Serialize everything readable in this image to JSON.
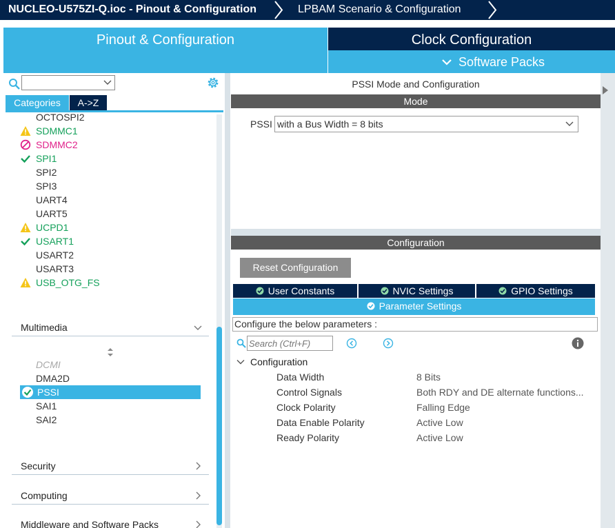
{
  "breadcrumb": {
    "project": "NUCLEO-U575ZI-Q.ioc - Pinout & Configuration",
    "step2": "LPBAM Scenario & Configuration"
  },
  "tabs": {
    "pinout": "Pinout & Configuration",
    "clock": "Clock Configuration",
    "software_packs": "Software Packs"
  },
  "left": {
    "search_value": "",
    "category_tabs": [
      "Categories",
      "A->Z"
    ],
    "connectivity_items": [
      {
        "label": "OCTOSPI2",
        "status": "none"
      },
      {
        "label": "SDMMC1",
        "status": "warning"
      },
      {
        "label": "SDMMC2",
        "status": "disabled"
      },
      {
        "label": "SPI1",
        "status": "ok"
      },
      {
        "label": "SPI2",
        "status": "none"
      },
      {
        "label": "SPI3",
        "status": "none"
      },
      {
        "label": "UART4",
        "status": "none"
      },
      {
        "label": "UART5",
        "status": "none"
      },
      {
        "label": "UCPD1",
        "status": "warning"
      },
      {
        "label": "USART1",
        "status": "ok"
      },
      {
        "label": "USART2",
        "status": "none"
      },
      {
        "label": "USART3",
        "status": "none"
      },
      {
        "label": "USB_OTG_FS",
        "status": "warning"
      }
    ],
    "multimedia": {
      "title": "Multimedia",
      "items": [
        "DCMI",
        "DMA2D",
        "PSSI",
        "SAI1",
        "SAI2"
      ],
      "selected": "PSSI"
    },
    "security": "Security",
    "computing": "Computing",
    "middleware": "Middleware and Software Packs"
  },
  "mode": {
    "title": "PSSI Mode and Configuration",
    "bar": "Mode",
    "pssi_label": "PSSI",
    "pssi_value": "with a Bus Width = 8 bits"
  },
  "config": {
    "bar": "Configuration",
    "reset": "Reset Configuration",
    "tabs": [
      "User Constants",
      "NVIC Settings",
      "GPIO Settings",
      "Parameter Settings"
    ],
    "hint": "Configure the below parameters :",
    "search_placeholder": "Search (Ctrl+F)",
    "group": "Configuration",
    "params": [
      {
        "name": "Data Width",
        "value": "8 Bits"
      },
      {
        "name": "Control Signals",
        "value": "Both RDY and DE alternate functions..."
      },
      {
        "name": "Clock Polarity",
        "value": "Falling Edge"
      },
      {
        "name": "Data Enable Polarity",
        "value": "Active Low"
      },
      {
        "name": "Ready Polarity",
        "value": "Active Low"
      }
    ]
  },
  "colors": {
    "navy": "#03234b",
    "accent": "#3ab4e3",
    "ok_green": "#14a05a",
    "warning": "#f5c518",
    "disabled_pink": "#e0218a"
  }
}
